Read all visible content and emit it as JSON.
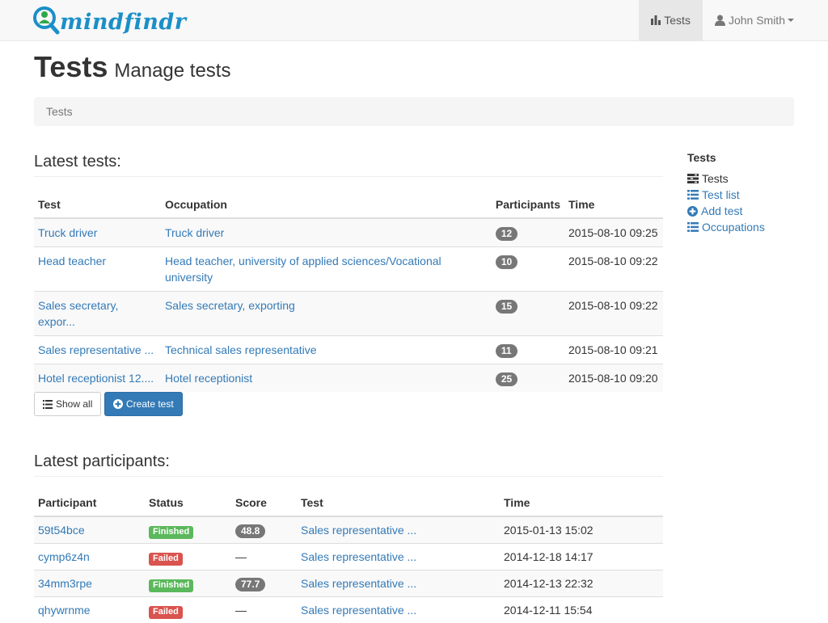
{
  "brand": {
    "name": "mindfindr",
    "color": "#1a8fc8"
  },
  "nav": {
    "tests_label": "Tests",
    "tests_icon": "bar-chart-icon",
    "user_label": "John Smith",
    "user_icon": "user-icon"
  },
  "header": {
    "title": "Tests",
    "subtitle": "Manage tests"
  },
  "breadcrumb": {
    "current": "Tests"
  },
  "latest_tests": {
    "heading": "Latest tests:",
    "columns": [
      "Test",
      "Occupation",
      "Participants",
      "Time"
    ],
    "rows": [
      {
        "test": "Truck driver",
        "occupation": "Truck driver",
        "participants": "12",
        "time": "2015-08-10 09:25"
      },
      {
        "test": "Head teacher",
        "occupation": "Head teacher, university of applied sciences/Vocational university",
        "participants": "10",
        "time": "2015-08-10 09:22"
      },
      {
        "test": "Sales secretary, expor...",
        "occupation": "Sales secretary, exporting",
        "participants": "15",
        "time": "2015-08-10 09:22"
      },
      {
        "test": "Sales representative ...",
        "occupation": "Technical sales representative",
        "participants": "11",
        "time": "2015-08-10 09:21"
      },
      {
        "test": "Hotel receptionist 12....",
        "occupation": "Hotel receptionist",
        "participants": "25",
        "time": "2015-08-10 09:20"
      }
    ],
    "show_all_label": "Show all",
    "create_label": "Create test"
  },
  "latest_participants": {
    "heading": "Latest participants:",
    "columns": [
      "Participant",
      "Status",
      "Score",
      "Test",
      "Time"
    ],
    "rows": [
      {
        "participant": "59t54bce",
        "status": "Finished",
        "status_kind": "success",
        "score": "48.8",
        "test": "Sales representative ...",
        "time": "2015-01-13 15:02"
      },
      {
        "participant": "cymp6z4n",
        "status": "Failed",
        "status_kind": "danger",
        "score": "—",
        "test": "Sales representative ...",
        "time": "2014-12-18 14:17"
      },
      {
        "participant": "34mm3rpe",
        "status": "Finished",
        "status_kind": "success",
        "score": "77.7",
        "test": "Sales representative ...",
        "time": "2014-12-13 22:32"
      },
      {
        "participant": "qhywrnme",
        "status": "Failed",
        "status_kind": "danger",
        "score": "—",
        "test": "Sales representative ...",
        "time": "2014-12-11 15:54"
      }
    ]
  },
  "sidebar": {
    "title": "Tests",
    "items": [
      {
        "label": "Tests",
        "icon": "tasks-icon"
      },
      {
        "label": "Test list",
        "icon": "list-icon"
      },
      {
        "label": "Add test",
        "icon": "plus-circle-icon"
      },
      {
        "label": "Occupations",
        "icon": "list-icon"
      }
    ]
  }
}
